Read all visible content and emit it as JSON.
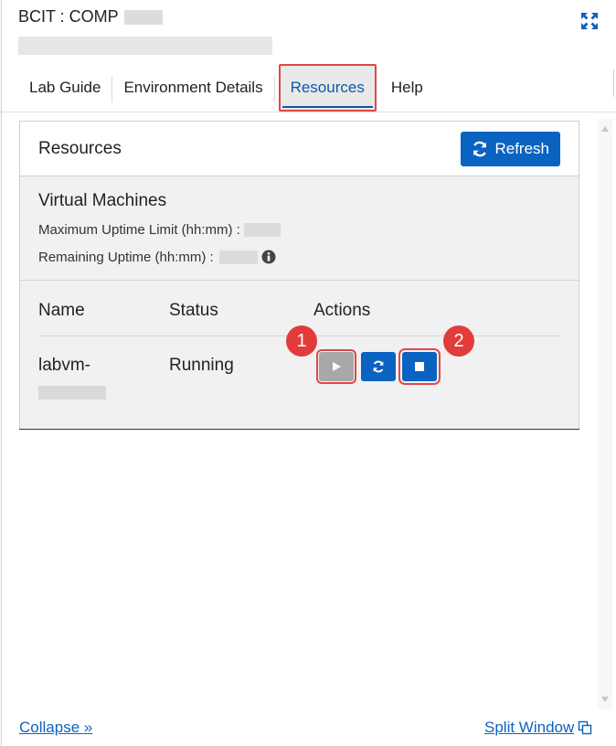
{
  "header": {
    "title": "BCIT : COMP"
  },
  "tabs": [
    {
      "label": "Lab Guide",
      "active": false
    },
    {
      "label": "Environment Details",
      "active": false
    },
    {
      "label": "Resources",
      "active": true
    },
    {
      "label": "Help",
      "active": false
    }
  ],
  "resources": {
    "title": "Resources",
    "refresh_label": "Refresh",
    "refresh_icon": "refresh-icon"
  },
  "vm": {
    "heading": "Virtual Machines",
    "max_uptime_label": "Maximum Uptime Limit (hh:mm) :",
    "remaining_uptime_label": "Remaining Uptime (hh:mm) :",
    "info_icon": "info-icon"
  },
  "table": {
    "headers": [
      "Name",
      "Status",
      "Actions"
    ],
    "rows": [
      {
        "name": "labvm-",
        "status": "Running",
        "actions": [
          "start",
          "restart",
          "stop"
        ]
      }
    ]
  },
  "annotations": [
    "1",
    "2"
  ],
  "footer": {
    "collapse_label": "Collapse »",
    "split_label": "Split Window"
  },
  "colors": {
    "accent": "#0b63c1",
    "highlight": "#e04848",
    "disabled": "#a8a8a8"
  }
}
